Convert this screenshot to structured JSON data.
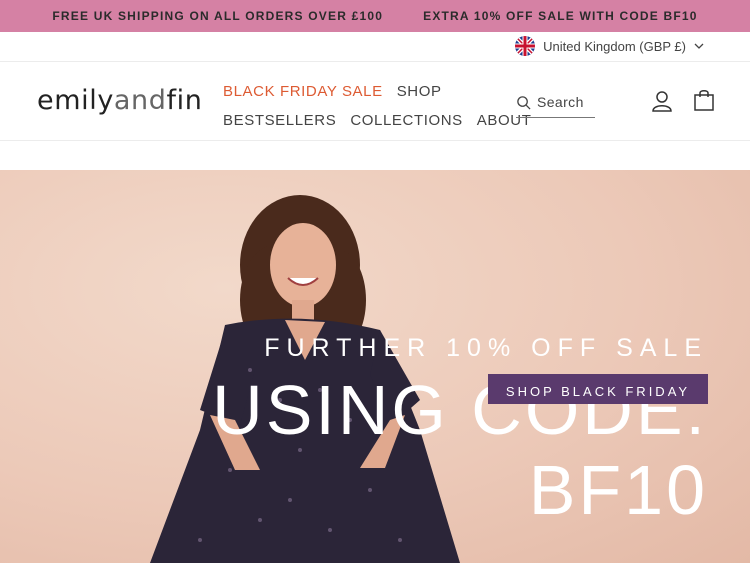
{
  "announcement": {
    "items": [
      "FREE UK SHIPPING ON ALL ORDERS OVER £100",
      "EXTRA 10% OFF SALE WITH CODE BF10"
    ],
    "bg_color": "#d581a4"
  },
  "locale": {
    "label": "United Kingdom (GBP £)",
    "flag_icon": "uk-flag-icon"
  },
  "header": {
    "logo": {
      "part1": "emily",
      "part2": "and",
      "part3": "fin"
    },
    "nav": {
      "row1": [
        "BLACK FRIDAY SALE",
        "SHOP"
      ],
      "row2": [
        "BESTSELLERS",
        "COLLECTIONS",
        "ABOUT"
      ]
    },
    "search_label": "Search",
    "icons": {
      "search": "search-icon",
      "account": "account-icon",
      "cart": "shopping-bag-icon"
    },
    "sale_color": "#dd5b33"
  },
  "hero": {
    "eyebrow": "FURTHER 10% OFF SALE",
    "headline_line1": "USING CODE:",
    "headline_line2": "BF10",
    "button_label": "SHOP BLACK FRIDAY",
    "button_color": "#5a3a6d"
  }
}
